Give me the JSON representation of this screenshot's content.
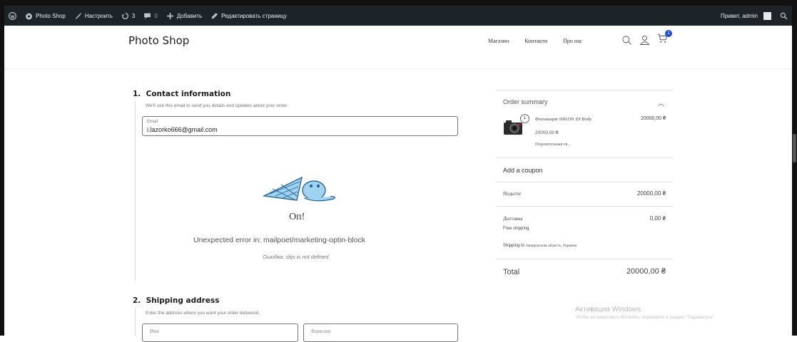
{
  "admin_bar": {
    "site_name": "Photo Shop",
    "customize": "Настроить",
    "updates_count": "3",
    "comments_count": "0",
    "add_new": "Добавить",
    "edit_page": "Редактировать страницу",
    "greeting": "Привет, admin"
  },
  "header": {
    "site_title": "Photo Shop",
    "nav": [
      "Магазин",
      "Контакти",
      "Про нас"
    ],
    "cart_count": "1"
  },
  "contact": {
    "number": "1.",
    "title": "Contact information",
    "description": "We'll use this email to send you details and updates about your order.",
    "email_label": "Email",
    "email_value": "i.lazorko666@gmail.com"
  },
  "error": {
    "title": "Оп!",
    "message": "Unexpected error in: mailpoet/marketing-optin-block",
    "detail": "Ошибка: sbjs is not defined"
  },
  "shipping": {
    "number": "2.",
    "title": "Shipping address",
    "description": "Enter the address where you want your order delivered.",
    "first_name_placeholder": "Имя",
    "last_name_placeholder": "Фамилия"
  },
  "summary": {
    "title": "Order summary",
    "product_name": "Фотоапарат NIKON Z9 Body",
    "product_qty": "1",
    "product_total": "20000,00 ₴",
    "product_price": "20000,00 ₴",
    "product_desc": "Поразительная св...",
    "coupon": "Add a coupon",
    "subtotal_label": "Подытог",
    "subtotal_value": "20000,00 ₴",
    "shipping_label": "Доставка",
    "shipping_value": "0,00 ₴",
    "shipping_method": "Free shipping",
    "shipping_to_prefix": "Shipping to",
    "shipping_to_place": "Запорожская область, Украина",
    "total_label": "Total",
    "total_value": "20000,00 ₴"
  },
  "watermark": {
    "line1": "Активация Windows",
    "line2": "Чтобы активировать Windows, перейдите в раздел \"Параметры\"."
  }
}
